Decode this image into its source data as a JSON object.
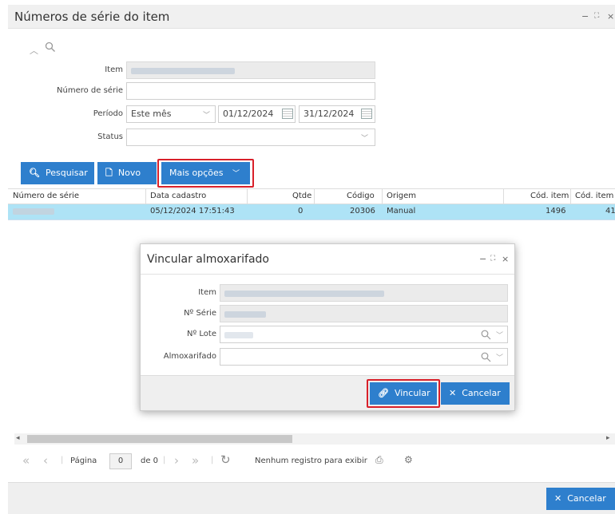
{
  "window": {
    "title": "Números de série do item",
    "controls": [
      "−",
      "⛶",
      "×"
    ]
  },
  "form": {
    "item_label": "Item",
    "serial_label": "Número de série",
    "period_label": "Período",
    "period_value": "Este mês",
    "date_from": "01/12/2024",
    "date_to": "31/12/2024",
    "status_label": "Status"
  },
  "toolbar": {
    "search_label": "Pesquisar",
    "new_label": "Novo",
    "more_label": "Mais opções"
  },
  "grid": {
    "columns": [
      "Número de série",
      "Data cadastro",
      "Qtde",
      "Código",
      "Origem",
      "Cód. item",
      "Cód. item"
    ],
    "row": {
      "date": "05/12/2024 17:51:43",
      "qty": "0",
      "code": "20306",
      "origin": "Manual",
      "item_code": "1496",
      "item_code2": "41"
    }
  },
  "pager": {
    "page_label": "Página",
    "page_value": "0",
    "of_label": "de 0",
    "empty_text": "Nenhum registro para exibir"
  },
  "footer": {
    "cancel_label": "Cancelar"
  },
  "modal": {
    "title": "Vincular almoxarifado",
    "item_label": "Item",
    "serial_label": "Nº Série",
    "lot_label": "Nº Lote",
    "warehouse_label": "Almoxarifado",
    "link_label": "Vincular",
    "cancel_label": "Cancelar"
  },
  "colors": {
    "accent": "#2e7fcd",
    "highlight_row": "#aee3f6",
    "annotation": "#d8202a"
  }
}
